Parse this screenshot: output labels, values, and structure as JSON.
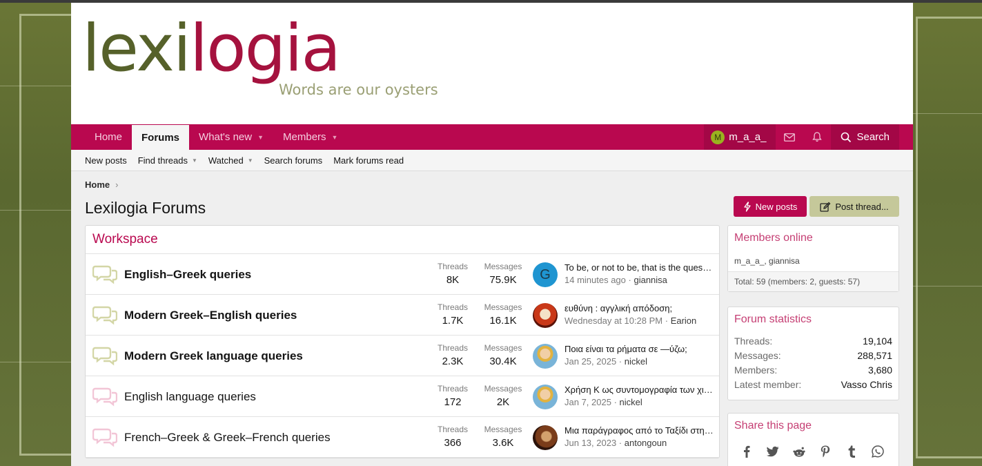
{
  "header": {
    "logo_part1": "lexi",
    "logo_part2": "logia",
    "tagline": "Words are our oysters"
  },
  "nav": {
    "tabs": [
      {
        "label": "Home"
      },
      {
        "label": "Forums"
      },
      {
        "label": "What's new"
      },
      {
        "label": "Members"
      }
    ],
    "user": {
      "initial": "M",
      "name": "m_a_a_"
    },
    "search_label": "Search"
  },
  "subnav": {
    "items": [
      {
        "label": "New posts"
      },
      {
        "label": "Find threads"
      },
      {
        "label": "Watched"
      },
      {
        "label": "Search forums"
      },
      {
        "label": "Mark forums read"
      }
    ]
  },
  "breadcrumb": {
    "home": "Home"
  },
  "page_title": "Lexilogia Forums",
  "buttons": {
    "new_posts": "New posts",
    "post_thread": "Post thread..."
  },
  "category": {
    "title": "Workspace"
  },
  "stat_labels": {
    "threads": "Threads",
    "messages": "Messages"
  },
  "forums": [
    {
      "title": "English–Greek queries",
      "threads": "8K",
      "messages": "75.9K",
      "last_title": "To be, or not to be, that is the question",
      "last_time": "14 minutes ago",
      "last_user": "giannisa",
      "avatar_letter": "G",
      "unread": true
    },
    {
      "title": "Modern Greek–English queries",
      "threads": "1.7K",
      "messages": "16.1K",
      "last_title": "ευθύνη : αγγλική απόδοση;",
      "last_time": "Wednesday at 10:28 PM",
      "last_user": "Earion",
      "avatar_letter": "",
      "unread": true
    },
    {
      "title": "Modern Greek language queries",
      "threads": "2.3K",
      "messages": "30.4K",
      "last_title": "Ποια είναι τα ρήματα σε —ύζω;",
      "last_time": "Jan 25, 2025",
      "last_user": "nickel",
      "avatar_letter": "",
      "unread": true
    },
    {
      "title": "English language queries",
      "threads": "172",
      "messages": "2K",
      "last_title": "Χρήση Κ ως συντομογραφία των χιλιάδων",
      "last_time": "Jan 7, 2025",
      "last_user": "nickel",
      "avatar_letter": "",
      "unread": false
    },
    {
      "title": "French–Greek & Greek–French queries",
      "threads": "366",
      "messages": "3.6K",
      "last_title": "Μια παράγραφος από το Ταξίδι στην άκρη της νύχτας",
      "last_time": "Jun 13, 2023",
      "last_user": "antongoun",
      "avatar_letter": "",
      "unread": false
    }
  ],
  "members_online": {
    "title": "Members online",
    "names": "m_a_a_, giannisa",
    "total": "Total: 59 (members: 2, guests: 57)"
  },
  "forum_statistics": {
    "title": "Forum statistics",
    "rows": [
      {
        "k": "Threads:",
        "v": "19,104"
      },
      {
        "k": "Messages:",
        "v": "288,571"
      },
      {
        "k": "Members:",
        "v": "3,680"
      },
      {
        "k": "Latest member:",
        "v": "Vasso Chris"
      }
    ]
  },
  "share": {
    "title": "Share this page",
    "icons": [
      "facebook-icon",
      "twitter-icon",
      "reddit-icon",
      "pinterest-icon",
      "tumblr-icon",
      "whatsapp-icon"
    ]
  },
  "colors": {
    "brand": "#b9084f",
    "brand_dark": "#a30746",
    "olive": "#56612a",
    "link_pink": "#c53e73"
  }
}
